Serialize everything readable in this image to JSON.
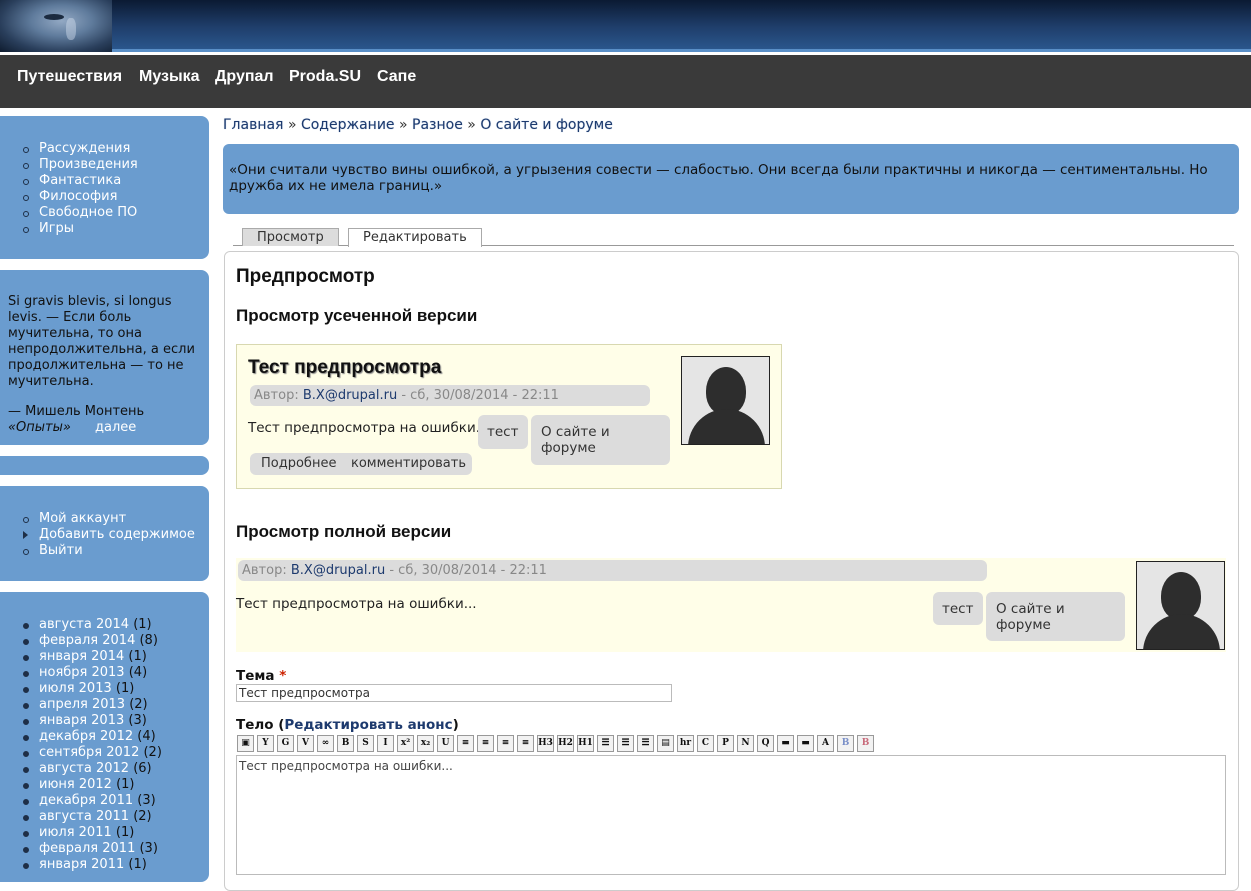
{
  "nav": [
    "Путешествия",
    "Музыка",
    "Друпал",
    "Proda.SU",
    "Сапе"
  ],
  "sidebar": {
    "categories": [
      "Рассуждения",
      "Произведения",
      "Фантастика",
      "Философия",
      "Свободное ПО",
      "Игры"
    ],
    "quote": {
      "text": "Si gravis blevis, si longus levis. — Если боль мучительна, то она непродолжительна, а если продолжительна — то не мучительна.",
      "author": "— Мишель Монтень",
      "source": "«Опыты»",
      "more": "далее"
    },
    "user_menu": [
      "Мой аккаунт",
      "Добавить содержимое",
      "Выйти"
    ],
    "archive": [
      {
        "label": "августа 2014",
        "count": "(1)"
      },
      {
        "label": "февраля 2014",
        "count": "(8)"
      },
      {
        "label": "января 2014",
        "count": "(1)"
      },
      {
        "label": "ноября 2013",
        "count": "(4)"
      },
      {
        "label": "июля 2013",
        "count": "(1)"
      },
      {
        "label": "апреля 2013",
        "count": "(2)"
      },
      {
        "label": "января 2013",
        "count": "(3)"
      },
      {
        "label": "декабря 2012",
        "count": "(4)"
      },
      {
        "label": "сентября 2012",
        "count": "(2)"
      },
      {
        "label": "августа 2012",
        "count": "(6)"
      },
      {
        "label": "июня 2012",
        "count": "(1)"
      },
      {
        "label": "декабря 2011",
        "count": "(3)"
      },
      {
        "label": "августа 2011",
        "count": "(2)"
      },
      {
        "label": "июля 2011",
        "count": "(1)"
      },
      {
        "label": "февраля 2011",
        "count": "(3)"
      },
      {
        "label": "января 2011",
        "count": "(1)"
      }
    ]
  },
  "breadcrumb": {
    "items": [
      "Главная",
      "Содержание",
      "Разное",
      "О сайте и форуме"
    ],
    "sep": "»"
  },
  "quote_box": "«Они считали чувство вины ошибкой, а угрызения совести — слабостью. Они всегда были практичны и никогда — сентиментальны. Но дружба их не имела границ.»",
  "tabs": [
    "Просмотр",
    "Редактировать"
  ],
  "preview": {
    "heading": "Предпросмотр",
    "teaser_heading": "Просмотр усеченной версии",
    "full_heading": "Просмотр полной версии",
    "node_title": "Тест предпросмотра",
    "meta_prefix": "Автор:",
    "author": "B.X@drupal.ru",
    "meta_date": "- сб, 30/08/2014 - 22:11",
    "body": "Тест предпросмотра на ошибки...",
    "tag1": "тест",
    "tag2": "О сайте и форуме",
    "read_more": "Подробнее",
    "comment": "комментировать"
  },
  "form": {
    "title_label": "Тема",
    "required_mark": "*",
    "title_value": "Тест предпросмотра",
    "body_label": "Тело",
    "edit_summary": "Редактировать анонс",
    "paren_open": "(",
    "paren_close": ")",
    "body_value": "Тест предпросмотра на ошибки...",
    "toolbar": [
      "img",
      "Y",
      "G",
      "V",
      "link",
      "B",
      "S",
      "I",
      "x²",
      "x₂",
      "U",
      "left",
      "center",
      "right",
      "justify",
      "H3",
      "H2",
      "H1",
      "ul",
      "ol",
      "ol2",
      "page",
      "hr",
      "C",
      "P",
      "N",
      "Q",
      "clr1",
      "clr2",
      "A",
      "B",
      "B"
    ]
  },
  "colors": {
    "sidebar": "#6a9ccf",
    "nav": "#3a3a3a",
    "highlight": "#fffee8",
    "link": "#1d3a6e"
  }
}
